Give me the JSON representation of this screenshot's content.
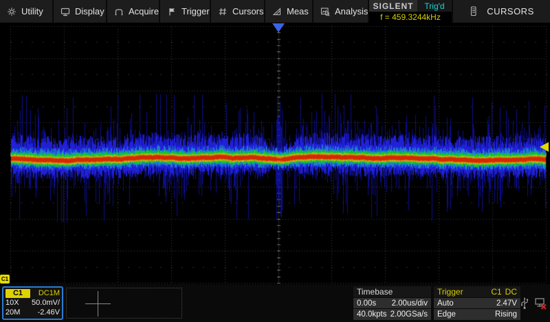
{
  "menu": {
    "items": [
      {
        "label": "Utility",
        "icon": "gear"
      },
      {
        "label": "Display",
        "icon": "monitor"
      },
      {
        "label": "Acquire",
        "icon": "arch"
      },
      {
        "label": "Trigger",
        "icon": "flag"
      },
      {
        "label": "Cursors",
        "icon": "hash"
      },
      {
        "label": "Meas",
        "icon": "slope-triangle"
      },
      {
        "label": "Analysis",
        "icon": "chart-magnifier"
      }
    ]
  },
  "brand": {
    "logo": "SIGLENT",
    "trig_status": "Trig'd",
    "frequency": "f = 459.3244kHz"
  },
  "dialog": {
    "title": "CURSORS",
    "icon": "notepad"
  },
  "markers": {
    "channel_tag": "C1"
  },
  "channel_box": {
    "name": "C1",
    "coupling": "DC1M",
    "probe": "10X",
    "scale": "50.0mV/",
    "bandwidth": "20M",
    "offset": "-2.46V"
  },
  "timebase_box": {
    "title": "Timebase",
    "delay": "0.00s",
    "scale": "2.00us/div",
    "memory": "40.0kpts",
    "sample_rate": "2.00GSa/s"
  },
  "trigger_box": {
    "title": "Trigger",
    "source": "C1",
    "coupling": "DC",
    "mode": "Auto",
    "level": "2.47V",
    "type": "Edge",
    "slope": "Rising"
  },
  "status_icons": {
    "usb": "usb-icon",
    "lan": "lan-disconnected-icon"
  },
  "colors": {
    "channel_yellow": "#ddd100",
    "trig_status_cyan": "#1bd6d6",
    "freq_yellow": "#d6cf00",
    "trigger_position_blue": "#3a64e8",
    "channel_select_border": "#2b7cd4"
  },
  "waveform": {
    "seed": 1337,
    "center": 198,
    "grid_color": "#3d3d3d",
    "tick_color": "#757575",
    "c_deep": "#0f10ae",
    "c_blue": "#2323e4",
    "c_cyan": "#1e9ec8",
    "c_green": "#16c434",
    "c_lime": "#9fce12",
    "c_orange": "#e57916",
    "c_red": "#d22a00"
  }
}
